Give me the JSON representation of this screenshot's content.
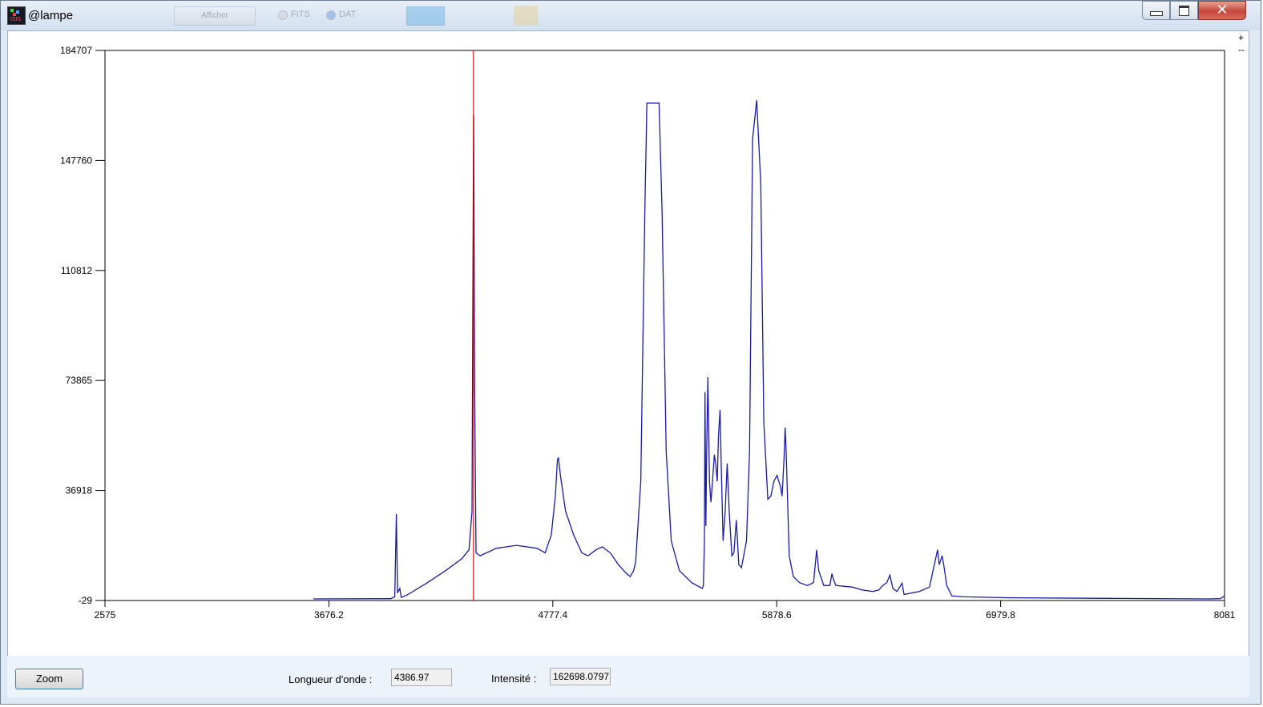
{
  "window": {
    "title": "@lampe",
    "background_toolbar": {
      "button_label": "Afficher",
      "radio_fits_label": "FITS",
      "radio_dat_label": "DAT"
    },
    "app_icon_text": "ISIS"
  },
  "plot_controls": {
    "plus": "+",
    "minus": "--"
  },
  "bottom": {
    "zoom_label": "Zoom",
    "wavelength_label": "Longueur d'onde :",
    "wavelength_value": "4386.97",
    "intensity_label": "Intensité :",
    "intensity_value": "162698.0797"
  },
  "colors": {
    "series": "#1a1aa8",
    "cursor": "#e00000",
    "axes": "#000000"
  },
  "chart_data": {
    "type": "line",
    "title": "",
    "xlabel": "",
    "ylabel": "",
    "xlim": [
      2575,
      8081
    ],
    "ylim": [
      -29,
      184707
    ],
    "x_ticks": [
      "2575",
      "3676.2",
      "4777.4",
      "5878.6",
      "6979.8",
      "8081"
    ],
    "y_ticks": [
      "-29",
      "36918",
      "73865",
      "110812",
      "147760",
      "184707"
    ],
    "cursor_x": 4386.97,
    "series": [
      {
        "points": [
          [
            3600,
            500
          ],
          [
            3980,
            600
          ],
          [
            4000,
            1200
          ],
          [
            4008,
            29000
          ],
          [
            4014,
            2500
          ],
          [
            4025,
            4000
          ],
          [
            4032,
            1000
          ],
          [
            4060,
            1800
          ],
          [
            4150,
            5500
          ],
          [
            4250,
            10000
          ],
          [
            4330,
            14000
          ],
          [
            4365,
            17000
          ],
          [
            4380,
            30000
          ],
          [
            4384,
            100000
          ],
          [
            4388,
            163000
          ],
          [
            4393,
            70000
          ],
          [
            4400,
            16000
          ],
          [
            4420,
            15000
          ],
          [
            4500,
            17500
          ],
          [
            4600,
            18500
          ],
          [
            4700,
            17500
          ],
          [
            4740,
            16000
          ],
          [
            4770,
            22000
          ],
          [
            4790,
            35000
          ],
          [
            4800,
            47000
          ],
          [
            4805,
            48000
          ],
          [
            4815,
            42000
          ],
          [
            4840,
            30000
          ],
          [
            4880,
            22000
          ],
          [
            4920,
            16000
          ],
          [
            4950,
            15000
          ],
          [
            4990,
            17000
          ],
          [
            5020,
            18000
          ],
          [
            5060,
            16000
          ],
          [
            5100,
            12000
          ],
          [
            5140,
            9000
          ],
          [
            5158,
            8000
          ],
          [
            5175,
            10000
          ],
          [
            5185,
            13000
          ],
          [
            5210,
            40000
          ],
          [
            5230,
            130000
          ],
          [
            5240,
            167000
          ],
          [
            5300,
            167000
          ],
          [
            5315,
            130000
          ],
          [
            5335,
            50000
          ],
          [
            5360,
            20000
          ],
          [
            5400,
            10000
          ],
          [
            5460,
            6000
          ],
          [
            5512,
            4000
          ],
          [
            5518,
            5000
          ],
          [
            5523,
            20000
          ],
          [
            5526,
            70000
          ],
          [
            5530,
            25000
          ],
          [
            5534,
            50000
          ],
          [
            5540,
            75000
          ],
          [
            5548,
            40000
          ],
          [
            5555,
            33000
          ],
          [
            5563,
            40000
          ],
          [
            5572,
            49000
          ],
          [
            5580,
            45000
          ],
          [
            5586,
            40000
          ],
          [
            5592,
            55000
          ],
          [
            5600,
            64000
          ],
          [
            5606,
            45000
          ],
          [
            5615,
            20000
          ],
          [
            5625,
            30000
          ],
          [
            5635,
            46000
          ],
          [
            5645,
            30000
          ],
          [
            5658,
            15000
          ],
          [
            5668,
            16000
          ],
          [
            5680,
            27000
          ],
          [
            5692,
            12000
          ],
          [
            5705,
            11000
          ],
          [
            5730,
            20000
          ],
          [
            5745,
            50000
          ],
          [
            5760,
            155000
          ],
          [
            5780,
            168000
          ],
          [
            5800,
            140000
          ],
          [
            5815,
            60000
          ],
          [
            5835,
            34000
          ],
          [
            5850,
            35000
          ],
          [
            5865,
            40000
          ],
          [
            5880,
            42000
          ],
          [
            5898,
            38000
          ],
          [
            5905,
            35000
          ],
          [
            5915,
            48000
          ],
          [
            5920,
            58000
          ],
          [
            5925,
            50000
          ],
          [
            5940,
            15000
          ],
          [
            5960,
            8000
          ],
          [
            5990,
            6000
          ],
          [
            6030,
            5000
          ],
          [
            6060,
            6000
          ],
          [
            6075,
            17000
          ],
          [
            6085,
            10000
          ],
          [
            6095,
            8000
          ],
          [
            6110,
            5000
          ],
          [
            6140,
            5000
          ],
          [
            6150,
            9000
          ],
          [
            6158,
            7000
          ],
          [
            6170,
            5000
          ],
          [
            6250,
            4500
          ],
          [
            6300,
            3500
          ],
          [
            6350,
            3000
          ],
          [
            6380,
            3500
          ],
          [
            6400,
            5000
          ],
          [
            6420,
            6000
          ],
          [
            6435,
            8500
          ],
          [
            6450,
            4000
          ],
          [
            6470,
            3000
          ],
          [
            6495,
            5800
          ],
          [
            6505,
            2000
          ],
          [
            6580,
            3000
          ],
          [
            6630,
            4500
          ],
          [
            6660,
            14000
          ],
          [
            6670,
            17000
          ],
          [
            6678,
            12000
          ],
          [
            6692,
            15000
          ],
          [
            6700,
            12000
          ],
          [
            6715,
            5000
          ],
          [
            6740,
            1500
          ],
          [
            6800,
            1200
          ],
          [
            7000,
            900
          ],
          [
            7500,
            700
          ],
          [
            8000,
            500
          ],
          [
            8060,
            600
          ],
          [
            8081,
            1500
          ]
        ]
      }
    ]
  }
}
